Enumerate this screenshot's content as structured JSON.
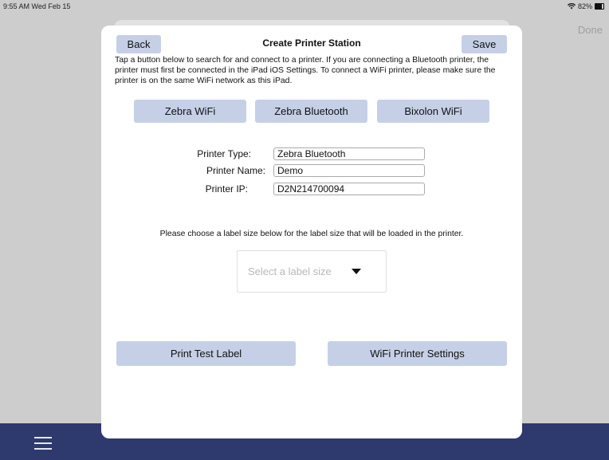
{
  "status": {
    "time_date": "9:55 AM  Wed Feb 15",
    "battery": "82%"
  },
  "background": {
    "done_label": "Done"
  },
  "modal": {
    "title": "Create Printer Station",
    "back_label": "Back",
    "save_label": "Save",
    "instructions": "Tap a button below to search for and connect to a printer. If you are connecting a Bluetooth printer, the printer must first be connected in the iPad iOS Settings. To connect a WiFi printer, please make sure the printer is on the same WiFi network as this iPad.",
    "printer_buttons": {
      "zebra_wifi": "Zebra WiFi",
      "zebra_bluetooth": "Zebra Bluetooth",
      "bixolon_wifi": "Bixolon WiFi"
    },
    "fields": {
      "type_label": "Printer Type:",
      "type_value": "Zebra Bluetooth",
      "name_label": "Printer Name:",
      "name_value": "Demo",
      "ip_label": "Printer IP:",
      "ip_value": "D2N214700094"
    },
    "label_size_prompt": "Please choose a label size below for the label size that will be loaded in the printer.",
    "label_size_placeholder": "Select a label size",
    "print_test_label": "Print Test Label",
    "wifi_printer_settings": "WiFi Printer Settings"
  }
}
